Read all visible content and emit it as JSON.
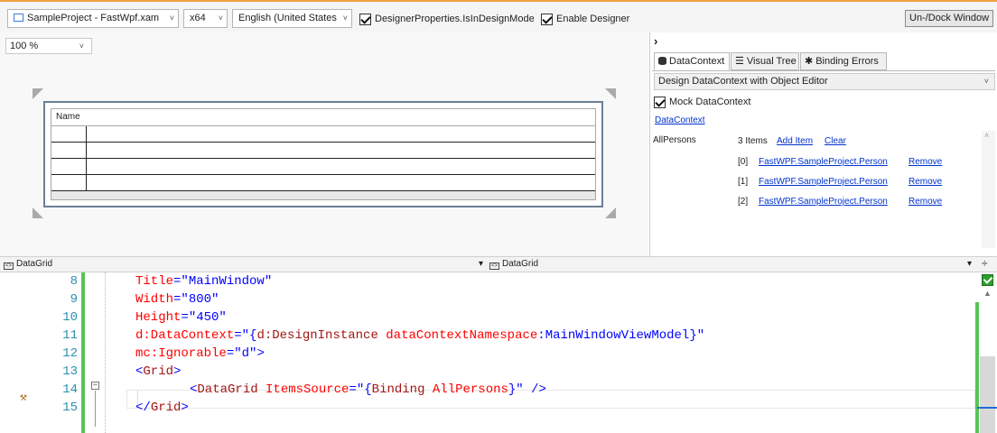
{
  "toolbar": {
    "project_combo": "SampleProject - FastWpf.xam",
    "platform_combo": "x64",
    "language_combo": "English (United States",
    "design_mode_label": "DesignerProperties.IsInDesignMode",
    "enable_designer_label": "Enable Designer",
    "dock_button": "Un-/Dock Window"
  },
  "design": {
    "zoom": "100 %",
    "grid_header": "Name",
    "grid_rows": 4
  },
  "panel": {
    "expander": "›",
    "tabs": [
      {
        "label": "DataContext",
        "icon": "database-icon",
        "active": true
      },
      {
        "label": "Visual Tree",
        "icon": "list-icon",
        "active": false
      },
      {
        "label": "Binding Errors",
        "icon": "bug-icon",
        "active": false
      }
    ],
    "editor_select": "Design DataContext with Object Editor",
    "mock_label": "Mock DataContext",
    "datacontext_link": "DataContext",
    "property_name": "AllPersons",
    "items_count": "3 Items",
    "add_item": "Add Item",
    "clear": "Clear",
    "items": [
      {
        "index": "[0]",
        "type": "FastWPF.SampleProject.Person",
        "remove": "Remove"
      },
      {
        "index": "[1]",
        "type": "FastWPF.SampleProject.Person",
        "remove": "Remove"
      },
      {
        "index": "[2]",
        "type": "FastWPF.SampleProject.Person",
        "remove": "Remove"
      }
    ]
  },
  "navbar": {
    "left": "DataGrid",
    "right": "DataGrid",
    "split_icon": "÷"
  },
  "editor": {
    "lines": [
      {
        "num": "8",
        "attr": "Title",
        "val": "\"MainWindow\"",
        "tail": ""
      },
      {
        "num": "9",
        "attr": "Width",
        "val": "\"800\"",
        "tail": ""
      },
      {
        "num": "10",
        "attr": "Height",
        "val": "\"450\"",
        "tail": ""
      },
      {
        "num": "11",
        "attr": "d:DataContext",
        "val": "\"{",
        "ext": "d:DesignInstance",
        "ext2": " dataContextNamespace",
        "ext3": ":MainWindowViewModel",
        "close": "}\""
      },
      {
        "num": "12",
        "attr": "mc:Ignorable",
        "val": "\"d\"",
        "tail": ">"
      },
      {
        "num": "13",
        "open": "<",
        "tag": "Grid",
        "closeb": ">"
      },
      {
        "num": "14",
        "open": "<",
        "tag": "DataGrid",
        "attr": " ItemsSource",
        "eq": "=",
        "val1": "\"{",
        "ext": "Binding",
        "ext2": " AllPersons",
        "val2": "}\"",
        "closeb": " />"
      },
      {
        "num": "15",
        "open": "</",
        "tag": "Grid",
        "closeb": ">"
      }
    ]
  }
}
